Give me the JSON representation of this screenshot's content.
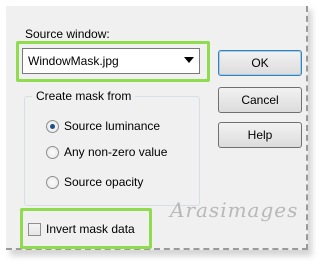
{
  "source": {
    "label": "Source window:",
    "selected": "WindowMask.jpg"
  },
  "buttons": {
    "ok": "OK",
    "cancel": "Cancel",
    "help": "Help"
  },
  "mask_group": {
    "title": "Create mask from",
    "options": [
      {
        "label": "Source luminance",
        "selected": true
      },
      {
        "label": "Any non-zero value",
        "selected": false
      },
      {
        "label": "Source opacity",
        "selected": false
      }
    ]
  },
  "invert": {
    "label": "Invert mask data",
    "checked": false
  },
  "watermark": "Arasimages",
  "colors": {
    "highlight": "#8fdc4f",
    "default_button_border": "#3c7fb1"
  }
}
